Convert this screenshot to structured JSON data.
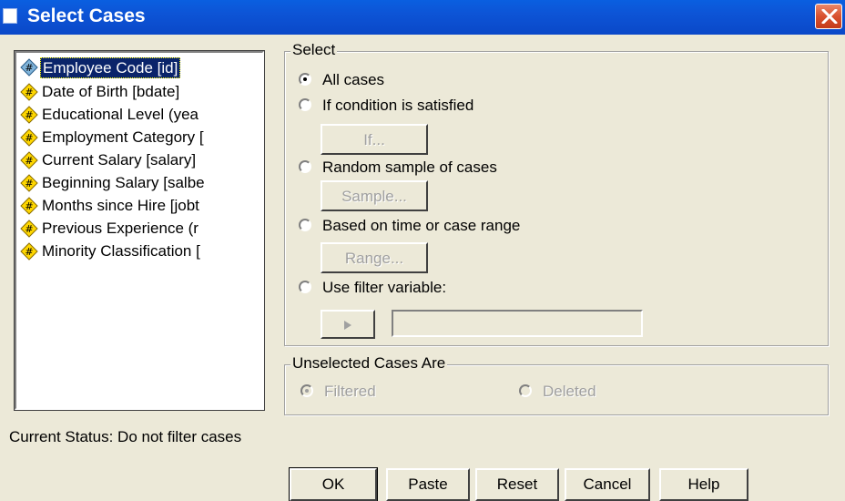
{
  "window": {
    "title": "Select Cases"
  },
  "variables": [
    {
      "label": "Employee Code [id]",
      "selected": true
    },
    {
      "label": "Date of Birth [bdate]",
      "selected": false
    },
    {
      "label": "Educational Level (yea",
      "selected": false
    },
    {
      "label": "Employment Category [",
      "selected": false
    },
    {
      "label": "Current Salary [salary]",
      "selected": false
    },
    {
      "label": "Beginning Salary [salbe",
      "selected": false
    },
    {
      "label": "Months since Hire [jobt",
      "selected": false
    },
    {
      "label": "Previous Experience (r",
      "selected": false
    },
    {
      "label": "Minority Classification [",
      "selected": false
    }
  ],
  "select_group": {
    "title": "Select",
    "options": {
      "all": "All cases",
      "condition": "If condition is satisfied",
      "random": "Random sample of cases",
      "range": "Based on time or case range",
      "filter": "Use filter variable:"
    },
    "selected": "all",
    "buttons": {
      "if": "If...",
      "sample": "Sample...",
      "range": "Range..."
    },
    "filter_value": ""
  },
  "unselected_group": {
    "title": "Unselected Cases Are",
    "filtered": "Filtered",
    "deleted": "Deleted",
    "selected": "filtered"
  },
  "status": "Current Status: Do not filter cases",
  "buttons": {
    "ok": "OK",
    "paste": "Paste",
    "reset": "Reset",
    "cancel": "Cancel",
    "help": "Help"
  },
  "colors": {
    "titlebar": "#0a54d6",
    "selection": "#0a246a",
    "dialog": "#ece9d8"
  }
}
